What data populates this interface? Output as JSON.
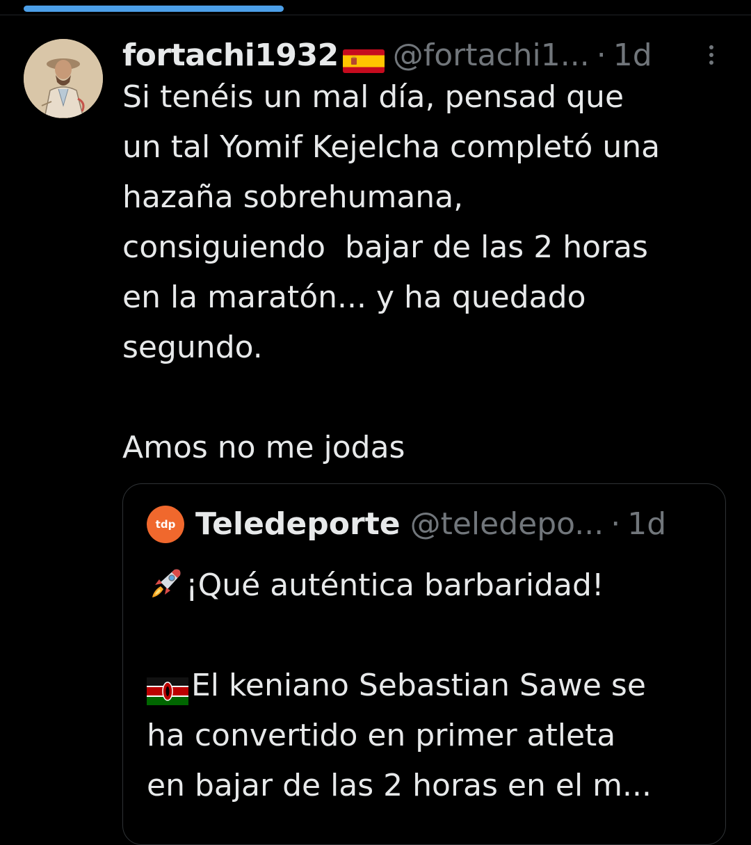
{
  "tweet": {
    "display_name": "fortachi1932",
    "name_flag_icon": "spain-flag-icon",
    "handle": "@fortachi1...",
    "separator": "·",
    "time": "1d",
    "more_icon": "more-vertical-icon",
    "text": "Si tenéis un mal día, pensad que\nun tal Yomif Kejelcha completó una\nhazaña sobrehumana,\nconsiguiendo  bajar de las 2 horas\nen la maratón... y ha quedado\nsegundo.\n\nAmos no me jodas"
  },
  "quote": {
    "avatar_text": "tdp",
    "display_name": "Teledeporte",
    "handle": "@teledepo...",
    "separator": "·",
    "time": "1d",
    "line1_icon": "rocket-icon",
    "line1": "¡Qué auténtica barbaridad!",
    "line2_icon": "kenya-flag-icon",
    "line2": "El keniano Sebastian Sawe se",
    "line3": "ha convertido en primer atleta",
    "line4": "en bajar de las 2 horas en el m..."
  },
  "colors": {
    "background": "#000000",
    "text_primary": "#e7e9ea",
    "text_secondary": "#71767b",
    "accent": "#4c9fe8",
    "border": "#2f3336",
    "tdp_orange": "#f0682d"
  }
}
